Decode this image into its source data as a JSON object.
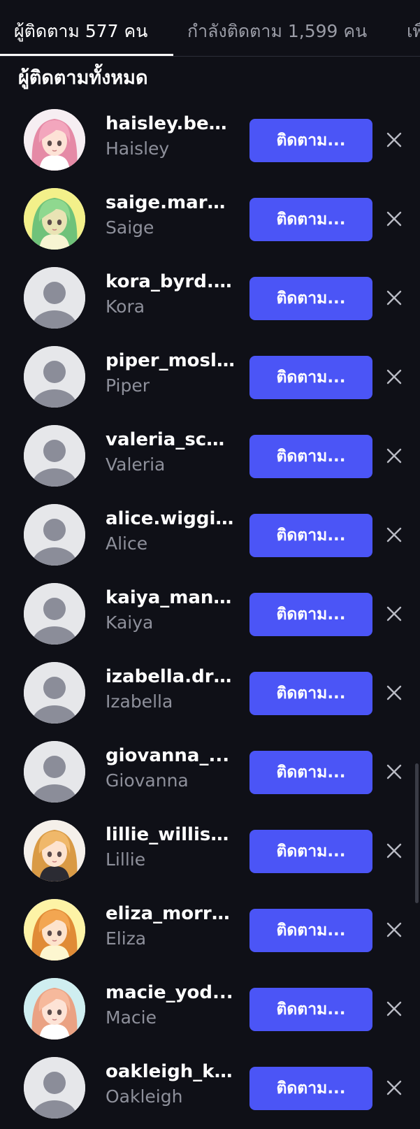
{
  "tabs": [
    {
      "label": "ผู้ติดตาม 577 คน",
      "active": true
    },
    {
      "label": "กำลังติดตาม 1,599 คน",
      "active": false
    },
    {
      "label": "เพื่อน",
      "active": false
    }
  ],
  "section_title": "ผู้ติดตามทั้งหมด",
  "follow_button_label": "ติดตาม...",
  "followers": [
    {
      "username": "haisley.ben...",
      "name": "Haisley",
      "avatar": "anime-pink-hair"
    },
    {
      "username": "saige.mars...",
      "name": "Saige",
      "avatar": "anime-green-hair"
    },
    {
      "username": "kora_byrd.l...",
      "name": "Kora",
      "avatar": "default"
    },
    {
      "username": "piper_mosl...",
      "name": "Piper",
      "avatar": "default"
    },
    {
      "username": "valeria_sch...",
      "name": "Valeria",
      "avatar": "default"
    },
    {
      "username": "alice.wiggi...",
      "name": "Alice",
      "avatar": "default"
    },
    {
      "username": "kaiya_mann...",
      "name": "Kaiya",
      "avatar": "default"
    },
    {
      "username": "izabella.dra...",
      "name": "Izabella",
      "avatar": "default"
    },
    {
      "username": "giovanna_...",
      "name": "Giovanna",
      "avatar": "default"
    },
    {
      "username": "lillie_willis_...",
      "name": "Lillie",
      "avatar": "anime-blonde-hair"
    },
    {
      "username": "eliza_morri...",
      "name": "Eliza",
      "avatar": "anime-orange-hair"
    },
    {
      "username": "macie_yod...",
      "name": "Macie",
      "avatar": "anime-peach-hair"
    },
    {
      "username": "oakleigh_k...",
      "name": "Oakleigh",
      "avatar": "default"
    }
  ],
  "colors": {
    "background": "#0f1017",
    "accent": "#4b55f6",
    "secondary_text": "#8e909b"
  }
}
